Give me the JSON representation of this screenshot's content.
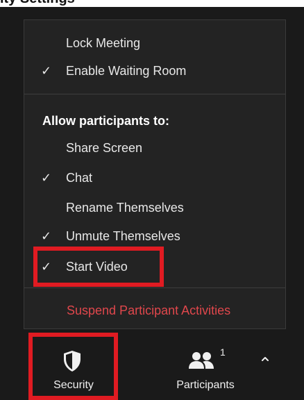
{
  "header": {
    "partial_title": "ity Settings"
  },
  "menu": {
    "lock_meeting": "Lock Meeting",
    "enable_waiting_room": "Enable Waiting Room",
    "allow_heading": "Allow participants to:",
    "share_screen": "Share Screen",
    "chat": "Chat",
    "rename_themselves": "Rename Themselves",
    "unmute_themselves": "Unmute Themselves",
    "start_video": "Start Video",
    "suspend": "Suspend Participant Activities",
    "checked": {
      "lock_meeting": false,
      "enable_waiting_room": true,
      "share_screen": false,
      "chat": true,
      "rename_themselves": false,
      "unmute_themselves": true,
      "start_video": true
    },
    "check_glyph": "✓"
  },
  "toolbar": {
    "security_label": "Security",
    "security_icon": "shield-icon",
    "participants_label": "Participants",
    "participants_icon": "participants-icon",
    "participants_count": "1",
    "caret_icon": "caret-up-icon"
  },
  "colors": {
    "background": "#1a1a1a",
    "menu_background": "#232323",
    "danger_text": "#e0474c",
    "highlight": "#e01b22"
  }
}
